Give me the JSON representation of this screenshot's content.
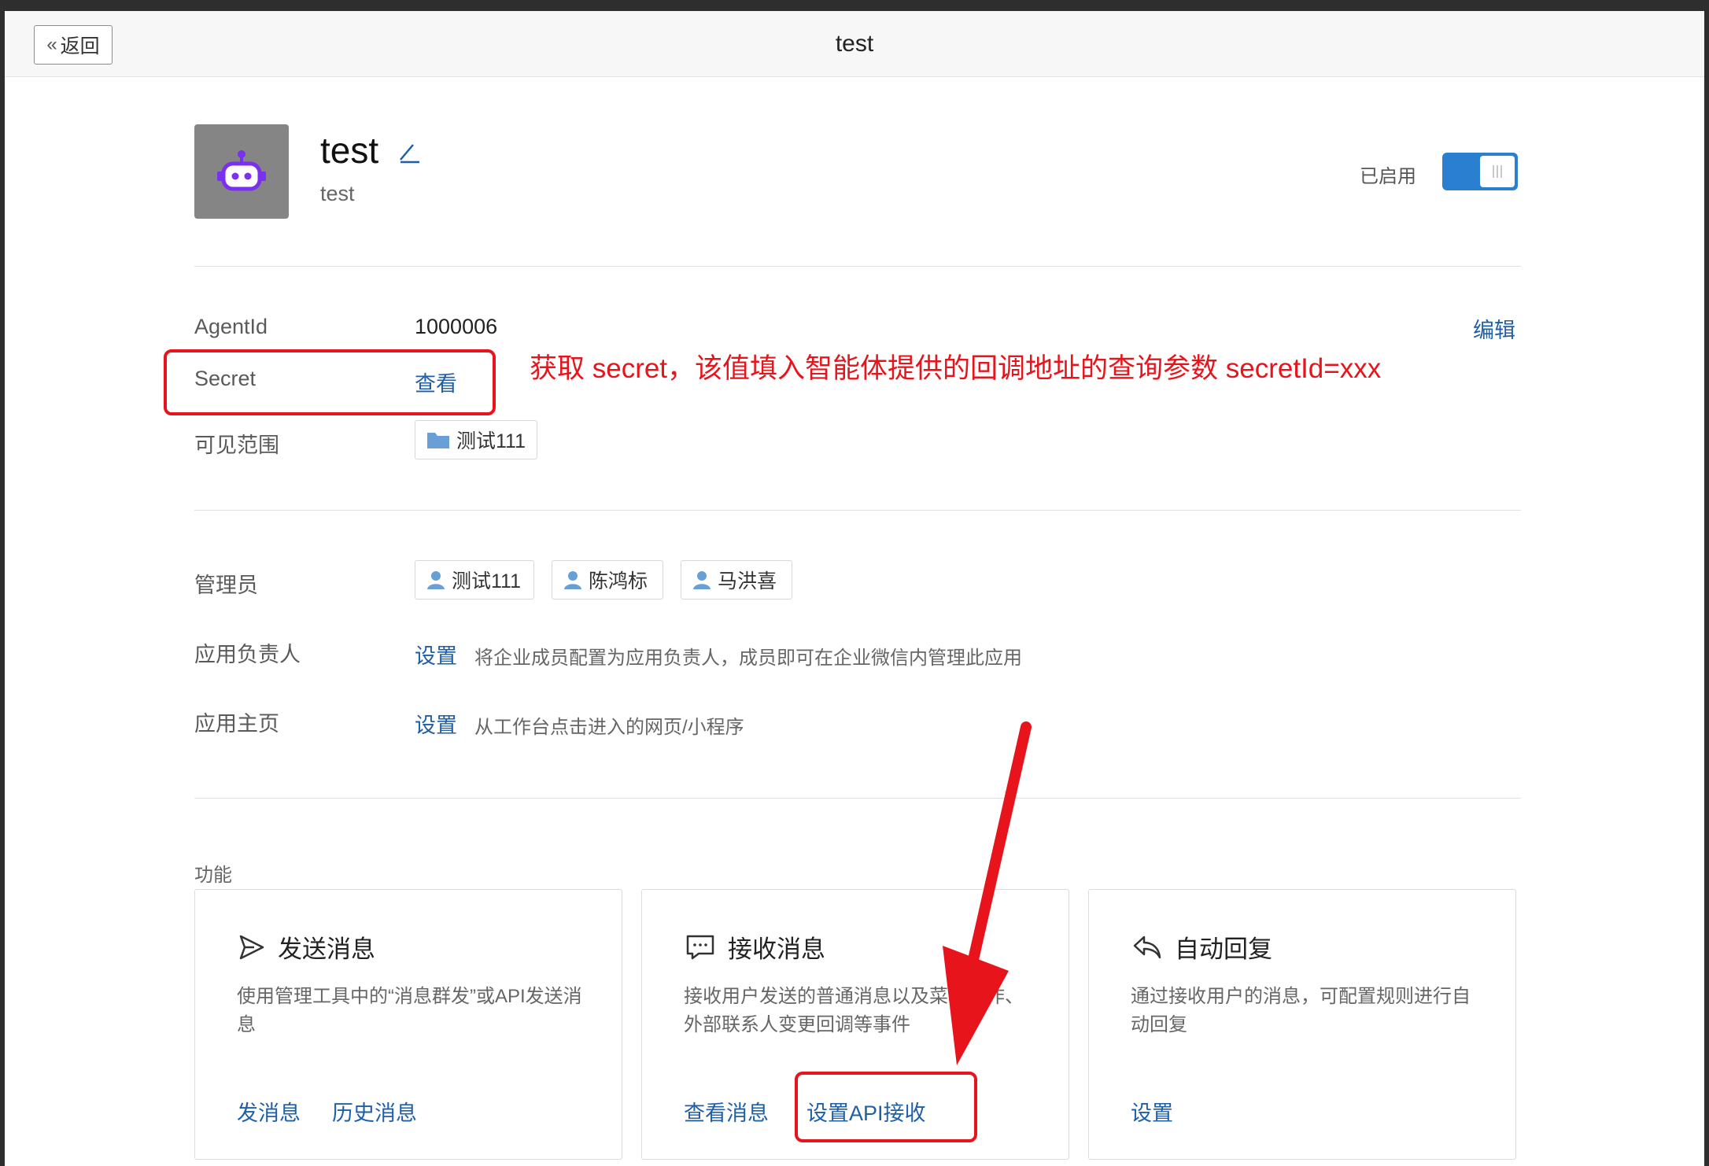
{
  "header": {
    "back_label": "返回",
    "title": "test"
  },
  "app": {
    "name": "test",
    "description": "test",
    "status_label": "已启用",
    "enabled": true
  },
  "details": {
    "edit_label": "编辑",
    "agentid_label": "AgentId",
    "agentid_value": "1000006",
    "secret_label": "Secret",
    "secret_action": "查看",
    "visibility_label": "可见范围",
    "visibility_tag": "测试111"
  },
  "management": {
    "admins_label": "管理员",
    "admins": [
      "测试111",
      "陈鸿标",
      "马洪喜"
    ],
    "owner_label": "应用负责人",
    "owner_action": "设置",
    "owner_desc": "将企业成员配置为应用负责人，成员即可在企业微信内管理此应用",
    "homepage_label": "应用主页",
    "homepage_action": "设置",
    "homepage_desc": "从工作台点击进入的网页/小程序"
  },
  "features": {
    "section_label": "功能",
    "cards": [
      {
        "icon": "send-icon",
        "title": "发送消息",
        "desc": "使用管理工具中的“消息群发”或API发送消息",
        "actions": [
          "发消息",
          "历史消息"
        ]
      },
      {
        "icon": "chat-icon",
        "title": "接收消息",
        "desc": "接收用户发送的普通消息以及菜单操作、外部联系人变更回调等事件",
        "actions": [
          "查看消息",
          "设置API接收"
        ]
      },
      {
        "icon": "reply-icon",
        "title": "自动回复",
        "desc": "通过接收用户的消息，可配置规则进行自动回复",
        "actions": [
          "设置"
        ]
      }
    ]
  },
  "annotation": {
    "text": "获取 secret，该值填入智能体提供的回调地址的查询参数 secretId=xxx",
    "color": "#e8141b"
  },
  "colors": {
    "link": "#1f5fa8",
    "toggle": "#2a7fd0",
    "avatar_bg": "#858585",
    "robot": "#7b2ff0"
  }
}
